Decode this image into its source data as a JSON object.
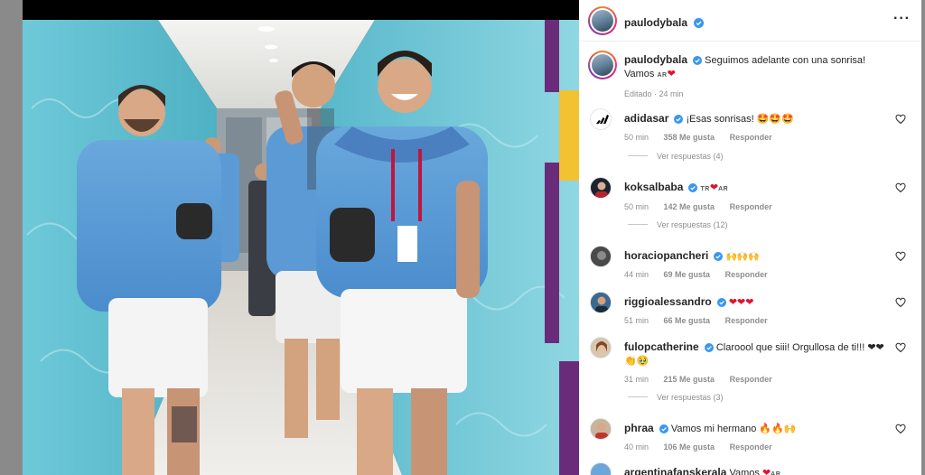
{
  "post": {
    "username": "paulodybala",
    "caption_text": "Seguimos adelante con una sonrisa!",
    "caption_line2": "Vamos",
    "caption_flag": "AR",
    "caption_heart": "❤",
    "edited": "Editado · 24 min"
  },
  "header": {
    "username": "paulodybala",
    "more_label": "···"
  },
  "comments": [
    {
      "user": "adidasar",
      "verified": true,
      "text": "¡Esas sonrisas! 🤩🤩🤩",
      "time": "50 min",
      "likes": "358 Me gusta",
      "reply": "Responder",
      "replies": "Ver respuestas (4)"
    },
    {
      "user": "koksalbaba",
      "verified": true,
      "text_flag1": "TR",
      "text_heart": "❤",
      "text_flag2": "AR",
      "time": "50 min",
      "likes": "142 Me gusta",
      "reply": "Responder",
      "replies": "Ver respuestas (12)"
    },
    {
      "user": "horaciopancheri",
      "verified": true,
      "text": "🙌🙌🙌",
      "time": "44 min",
      "likes": "69 Me gusta",
      "reply": "Responder"
    },
    {
      "user": "riggioalessandro",
      "verified": true,
      "text": "❤❤❤",
      "time": "51 min",
      "likes": "66 Me gusta",
      "reply": "Responder"
    },
    {
      "user": "fulopcatherine",
      "verified": true,
      "text": "Claroool que siii! Orgullosa de ti!!! ❤❤👏🥹",
      "time": "31 min",
      "likes": "215 Me gusta",
      "reply": "Responder",
      "replies": "Ver respuestas (3)"
    },
    {
      "user": "phraa",
      "verified": true,
      "text": "Vamos mi hermano 🔥🔥🙌",
      "time": "40 min",
      "likes": "106 Me gusta",
      "reply": "Responder"
    },
    {
      "user": "argentinafanskerala",
      "verified": false,
      "text": "Vamos",
      "text_heart": "❤",
      "text_flag": "AR"
    }
  ],
  "colors": {
    "verified": "#3897f0",
    "heart": "#e0142e",
    "meta_text": "#8e8e8e",
    "primary_text": "#262626"
  },
  "icons": [
    "verified-badge-icon",
    "heart-outline-icon",
    "more-options-icon"
  ]
}
